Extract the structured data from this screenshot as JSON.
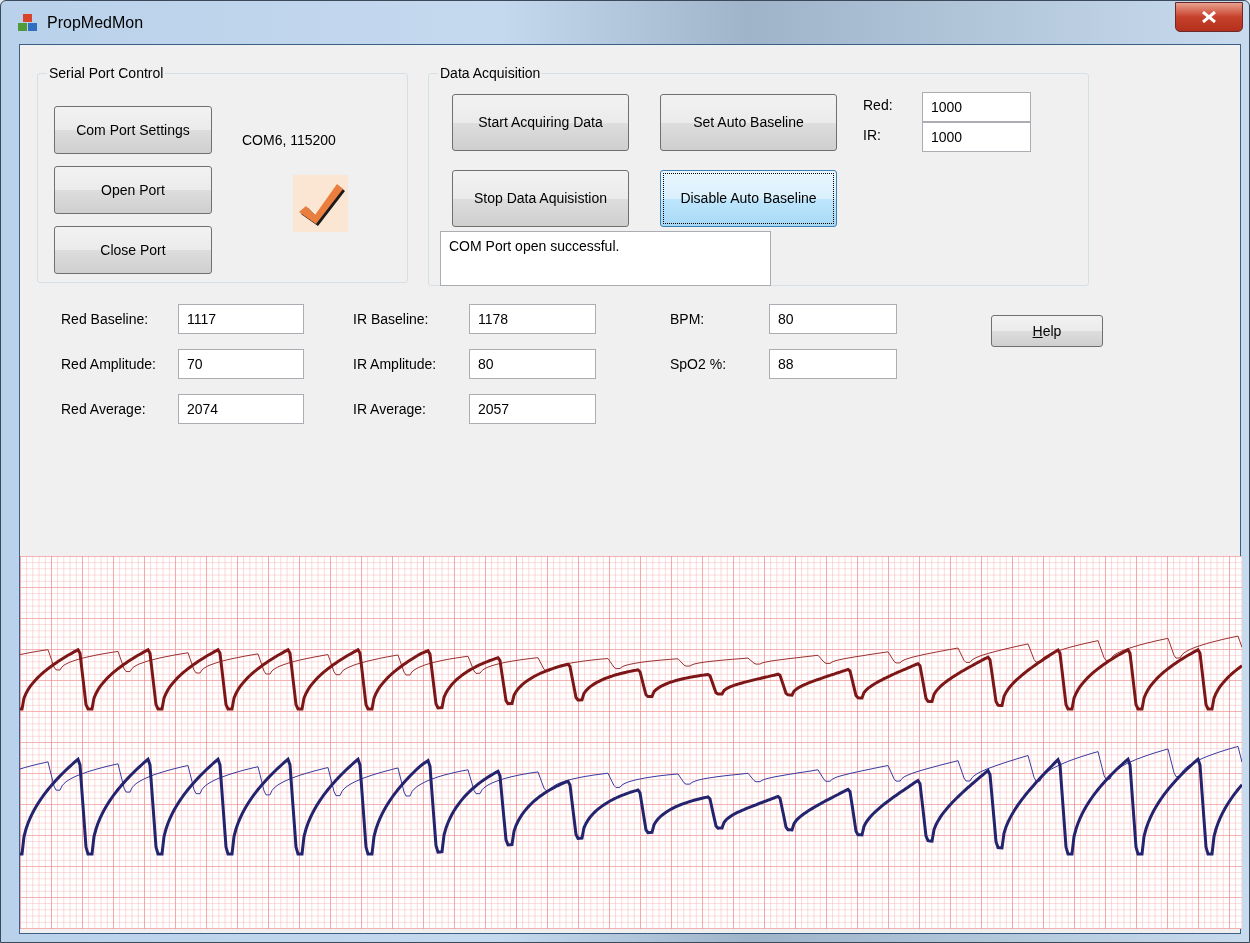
{
  "window": {
    "title": "PropMedMon"
  },
  "serial_port_control": {
    "title": "Serial Port Control",
    "buttons": [
      {
        "label": "Com Port Settings",
        "focused": false
      },
      {
        "label": "Open Port",
        "focused": false
      },
      {
        "label": "Close Port",
        "focused": false
      }
    ],
    "port_setting": "COM6, 115200",
    "connected": true
  },
  "data_acquisition": {
    "title": "Data Acquisition",
    "buttons": [
      {
        "label": "Start Acquiring Data",
        "focused": false
      },
      {
        "label": "Set Auto Baseline",
        "focused": false
      },
      {
        "label": "Stop Data Aquisistion",
        "focused": false
      },
      {
        "label": "Disable Auto Baseline",
        "focused": true
      }
    ],
    "baseline_inputs": [
      {
        "label": "Red:",
        "value": "1000"
      },
      {
        "label": "IR:",
        "value": "1000"
      }
    ],
    "status_message": "COM Port open successful."
  },
  "readings": [
    [
      {
        "label": "Red Baseline:",
        "value": "1117"
      },
      {
        "label": "Red Amplitude:",
        "value": "70"
      },
      {
        "label": "Red Average:",
        "value": "2074"
      }
    ],
    [
      {
        "label": "IR Baseline:",
        "value": "1178"
      },
      {
        "label": "IR Amplitude:",
        "value": "80"
      },
      {
        "label": "IR Average:",
        "value": "2057"
      }
    ],
    [
      {
        "label": "BPM:",
        "value": "80"
      },
      {
        "label": "SpO2 %:",
        "value": "88"
      }
    ]
  ],
  "help_button": {
    "label": "Help",
    "mnemonic_underlined": true
  }
}
